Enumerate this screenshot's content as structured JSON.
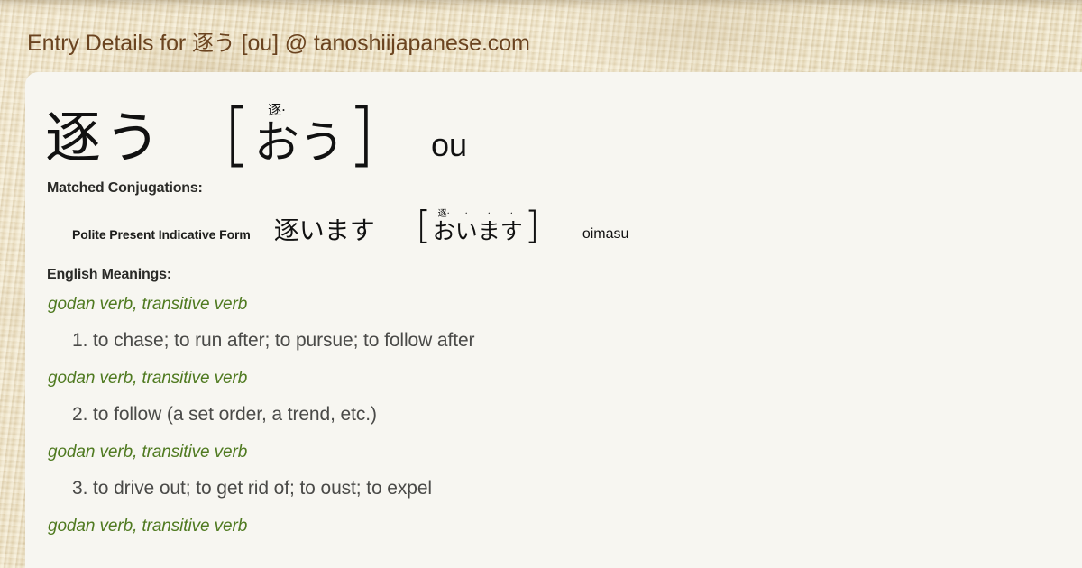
{
  "page": {
    "title_prefix": "Entry Details for ",
    "title_word": "逐う",
    "title_suffix": " [ou] @ tanoshiijapanese.com",
    "accent_color": "#6b4420",
    "pos_color": "#4f7a20",
    "card_color": "#f7f6f1",
    "bg_color": "#e5d7b7"
  },
  "entry": {
    "kanji": "逐う",
    "bracket_open": "［",
    "bracket_close": "］",
    "reading_units": [
      {
        "ruby": "逐·",
        "base": "お"
      },
      {
        "ruby": "",
        "base": "う"
      }
    ],
    "romaji": "ou"
  },
  "matched_conjugations": {
    "label": "Matched Conjugations:",
    "rows": [
      {
        "name": "Polite Present Indicative Form",
        "kanji": "逐います",
        "bracket_open": "［",
        "bracket_close": "］",
        "reading_units": [
          {
            "ruby": "逐·",
            "base": "お"
          },
          {
            "ruby": "·",
            "base": "い"
          },
          {
            "ruby": "·",
            "base": "ま"
          },
          {
            "ruby": "·",
            "base": "す"
          }
        ],
        "romaji": "oimasu"
      }
    ]
  },
  "english_meanings": {
    "label": "English Meanings:",
    "senses": [
      {
        "pos": "godan verb, transitive verb",
        "text": "1. to chase; to run after; to pursue; to follow after"
      },
      {
        "pos": "godan verb, transitive verb",
        "text": "2. to follow (a set order, a trend, etc.)"
      },
      {
        "pos": "godan verb, transitive verb",
        "text": "3. to drive out; to get rid of; to oust; to expel"
      },
      {
        "pos": "godan verb, transitive verb",
        "text": ""
      }
    ]
  }
}
